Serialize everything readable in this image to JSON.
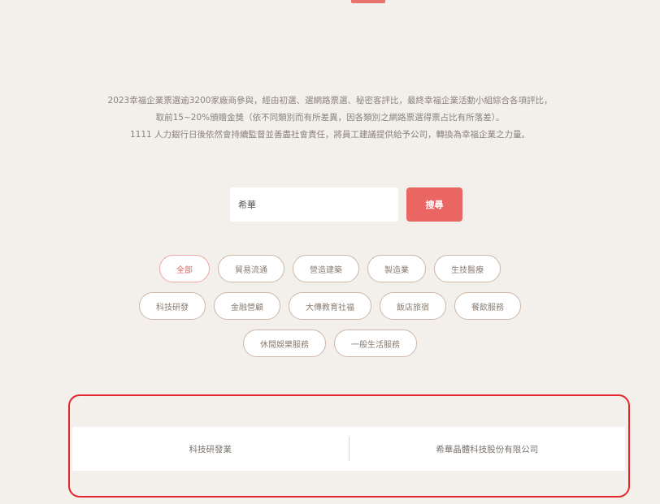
{
  "intro": {
    "line1": "2023幸福企業票選逾3200家廠商參與，經由初選、選網路票選、秘密客評比，最終幸福企業活動小組綜合各項評比，",
    "line2": "取前15~20%頒贈金獎（依不同類別而有所差異，因各類別之網路票選得票占比有所落差）。",
    "line3": "1111 人力銀行日後依然會持續監督並善盡社會責任，將員工建議提供給予公司，轉換為幸福企業之力量。"
  },
  "search": {
    "value": "希華",
    "button_label": "搜尋"
  },
  "tags": {
    "row1": [
      "全部",
      "貿易流通",
      "營造建築",
      "製造業",
      "生技醫療"
    ],
    "row2": [
      "科技研發",
      "金融營顧",
      "大傳教育社福",
      "飯店旅宿",
      "餐飲服務"
    ],
    "row3": [
      "休閒娛樂服務",
      "一般生活服務"
    ]
  },
  "result": {
    "category": "科技研發業",
    "company": "希華晶體科技股份有限公司"
  },
  "colors": {
    "accent": "#e96663",
    "highlight_border": "#e2262b",
    "background": "#f3efea"
  }
}
